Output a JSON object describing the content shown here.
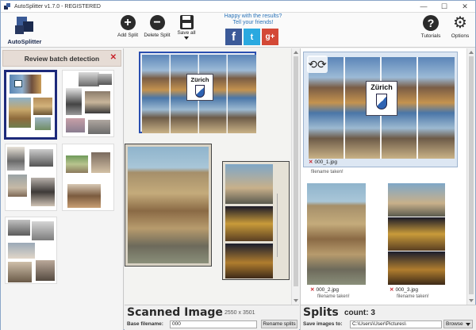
{
  "window": {
    "title": "AutoSplitter v1.7.0 - REGISTERED",
    "minimize": "—",
    "maximize": "☐",
    "close": "✕"
  },
  "toolbar": {
    "logo_text": "AutoSplitter",
    "add_split": "Add Split",
    "delete_split": "Delete Split",
    "save_all": "Save all",
    "promo_line1": "Happy with the results?",
    "promo_line2": "Tell your friends!",
    "tutorials": "Tutorials",
    "options": "Options",
    "facebook": "f",
    "twitter": "t",
    "googleplus": "g+"
  },
  "left_panel": {
    "header": "Review batch detection",
    "close": "✕"
  },
  "center": {
    "title": "Scanned Image",
    "dimensions": "2550 x 3501",
    "postcard_label": "Zürich",
    "base_filename_label": "Base filename:",
    "base_filename_value": "000",
    "rename_button": "Rename splits"
  },
  "right": {
    "title": "Splits",
    "count_label": "count:",
    "count_value": "3",
    "postcard_label": "Zürich",
    "save_images_label": "Save images to:",
    "save_path": "C:\\Users\\User\\Pictures\\",
    "browse_button": "Browse",
    "splits": [
      {
        "file": "000_1.jpg",
        "status": "filename taken!"
      },
      {
        "file": "000_2.jpg",
        "status": "filename taken!"
      },
      {
        "file": "000_3.jpg",
        "status": "filename taken!"
      }
    ]
  },
  "colors": {
    "accent": "#1d2a7a",
    "error": "#c8222a",
    "promo_text": "#2a73b8",
    "selection_bg": "#dde7f3"
  }
}
